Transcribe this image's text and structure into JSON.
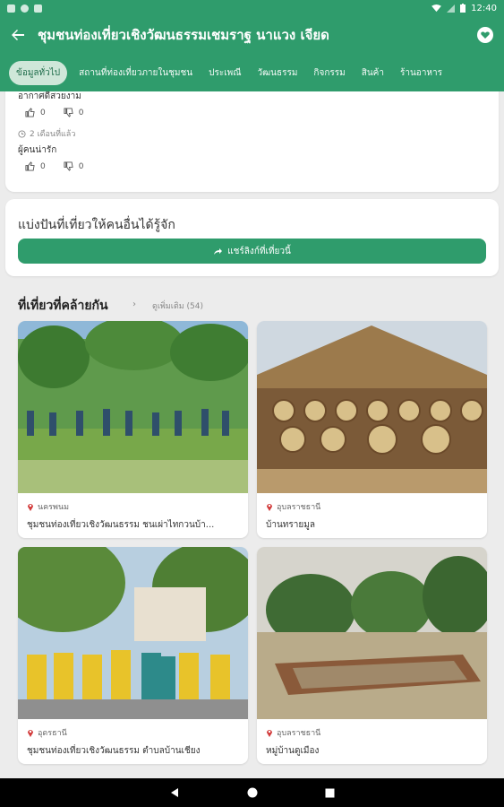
{
  "status": {
    "time": "12:40"
  },
  "header": {
    "title": "ชุมชนท่องเที่ยวเชิงวัฒนธรรมเชมราฐ นาแวง เจียด"
  },
  "tabs": [
    {
      "label": "ข้อมูลทั่วไป",
      "active": true
    },
    {
      "label": "สถานที่ท่องเที่ยวภายในชุมชน"
    },
    {
      "label": "ประเพณี"
    },
    {
      "label": "วัฒนธรรม"
    },
    {
      "label": "กิจกรรม"
    },
    {
      "label": "สินค้า"
    },
    {
      "label": "ร้านอาหาร"
    }
  ],
  "reviews": [
    {
      "text": "อากาศดีสวยงาม",
      "likes": "0",
      "dislikes": "0"
    },
    {
      "meta": "2 เดือนที่แล้ว",
      "text": "ผู้คนน่ารัก",
      "likes": "0",
      "dislikes": "0"
    }
  ],
  "share": {
    "heading": "แบ่งปันที่เที่ยวให้คนอื่นได้รู้จัก",
    "button": "แชร์ลิงก์ที่เที่ยวนี้"
  },
  "similar": {
    "title": "ที่เที่ยวที่คล้ายกัน",
    "more": "ดูเพิ่มเติม (54)"
  },
  "places": [
    {
      "province": "นครพนม",
      "name": "ชุมชนท่องเที่ยวเชิงวัฒนธรรม ชนเผ่าไทกวนบ้า..."
    },
    {
      "province": "อุบลราชธานี",
      "name": "บ้านทรายมูล"
    },
    {
      "province": "อุดรธานี",
      "name": "ชุมชนท่องเที่ยวเชิงวัฒนธรรม ตำบลบ้านเชียง"
    },
    {
      "province": "อุบลราชธานี",
      "name": "หมู่บ้านดูเมือง"
    }
  ],
  "colors": {
    "primary": "#2f9c6c",
    "pin": "#d23b3b"
  }
}
